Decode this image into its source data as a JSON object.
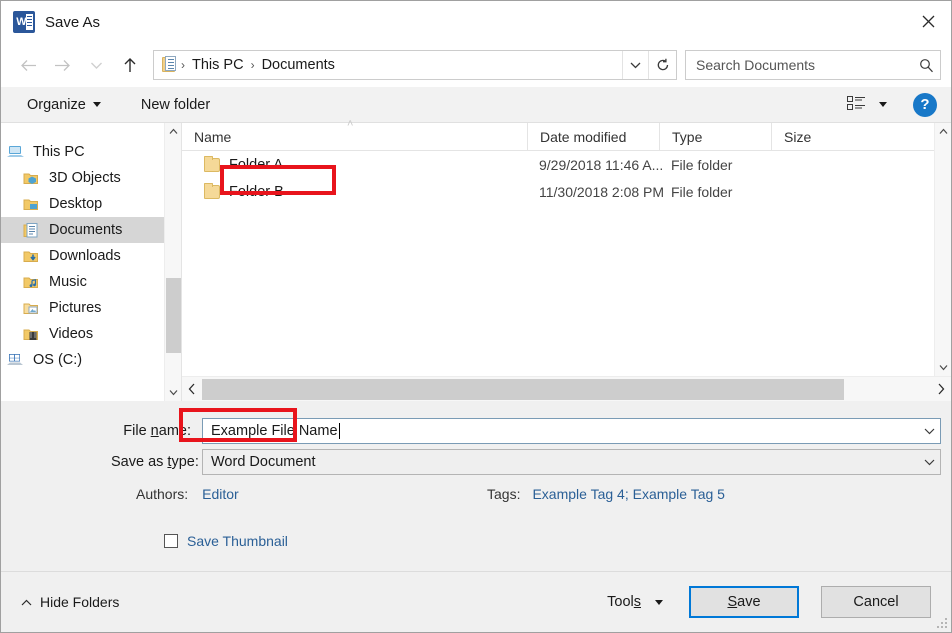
{
  "window": {
    "title": "Save As",
    "app_icon": "word-icon",
    "close_label": "✕"
  },
  "navigation": {
    "back_icon": "back-arrow-icon",
    "forward_icon": "forward-arrow-icon",
    "recent_icon": "recent-locations-chevron-icon",
    "up_icon": "up-arrow-icon",
    "address_icon": "documents-folder-icon",
    "breadcrumbs": [
      "This PC",
      "Documents"
    ],
    "separator": "›",
    "dropdown_icon": "chevron-down-icon",
    "refresh_icon": "refresh-icon"
  },
  "search": {
    "placeholder": "Search Documents",
    "icon": "search-icon"
  },
  "command_bar": {
    "organize": "Organize",
    "new_folder": "New folder",
    "view_icon": "list-view-icon",
    "view_caret_icon": "chevron-down-icon",
    "help_icon": "help-question-icon",
    "help_label": "?"
  },
  "sidebar": {
    "items": [
      {
        "label": "This PC",
        "icon": "this-pc-icon",
        "level": "root",
        "selected": false
      },
      {
        "label": "3D Objects",
        "icon": "3d-objects-folder-icon",
        "level": "child",
        "selected": false
      },
      {
        "label": "Desktop",
        "icon": "desktop-folder-icon",
        "level": "child",
        "selected": false
      },
      {
        "label": "Documents",
        "icon": "documents-folder-icon",
        "level": "child",
        "selected": true
      },
      {
        "label": "Downloads",
        "icon": "downloads-folder-icon",
        "level": "child",
        "selected": false
      },
      {
        "label": "Music",
        "icon": "music-folder-icon",
        "level": "child",
        "selected": false
      },
      {
        "label": "Pictures",
        "icon": "pictures-folder-icon",
        "level": "child",
        "selected": false
      },
      {
        "label": "Videos",
        "icon": "videos-folder-icon",
        "level": "child",
        "selected": false
      },
      {
        "label": "OS (C:)",
        "icon": "drive-icon",
        "level": "root",
        "selected": false
      }
    ],
    "scroll_up_icon": "chevron-up-icon",
    "scroll_down_icon": "chevron-down-icon"
  },
  "file_list": {
    "columns": [
      "Name",
      "Date modified",
      "Type",
      "Size"
    ],
    "sort_indicator": "˄",
    "rows": [
      {
        "name": "Folder A",
        "date_modified": "9/29/2018 11:46 A...",
        "type": "File folder",
        "size": "",
        "icon": "folder-icon",
        "highlighted": true
      },
      {
        "name": "Folder B",
        "date_modified": "11/30/2018 2:08 PM",
        "type": "File folder",
        "size": "",
        "icon": "folder-icon",
        "highlighted": false
      }
    ],
    "hscroll_left_icon": "chevron-left-icon",
    "hscroll_right_icon": "chevron-right-icon"
  },
  "form": {
    "file_name_label_pre": "File ",
    "file_name_label_accel": "n",
    "file_name_label_post": "ame:",
    "file_name_value": "Example File Name",
    "file_name_caret": true,
    "save_as_type_label_pre": "Save as ",
    "save_as_type_label_accel": "t",
    "save_as_type_label_post": "ype:",
    "save_as_type_value": "Word Document",
    "combo_caret_icon": "chevron-down-icon",
    "authors_label": "Authors:",
    "authors_value": "Editor",
    "tags_label": "Tags:",
    "tags_value": "Example Tag 4; Example Tag 5",
    "save_thumbnail_label": "Save Thumbnail",
    "save_thumbnail_checked": false
  },
  "footer": {
    "hide_folders_label": "Hide Folders",
    "hide_folders_icon": "chevron-up-icon",
    "tools_label": "Tools",
    "tools_caret_icon": "chevron-down-icon",
    "save_label_pre": "",
    "save_label_accel": "S",
    "save_label_post": "ave",
    "cancel_label": "Cancel",
    "resize_grip_icon": "resize-grip-icon"
  },
  "colors": {
    "accent_blue": "#0078d7",
    "annotation_red": "#e8141c",
    "link_blue": "#2a5f96",
    "word_blue": "#2b579a",
    "selection_gray": "#d6d6d6",
    "panel_gray": "#f0f0f0"
  }
}
